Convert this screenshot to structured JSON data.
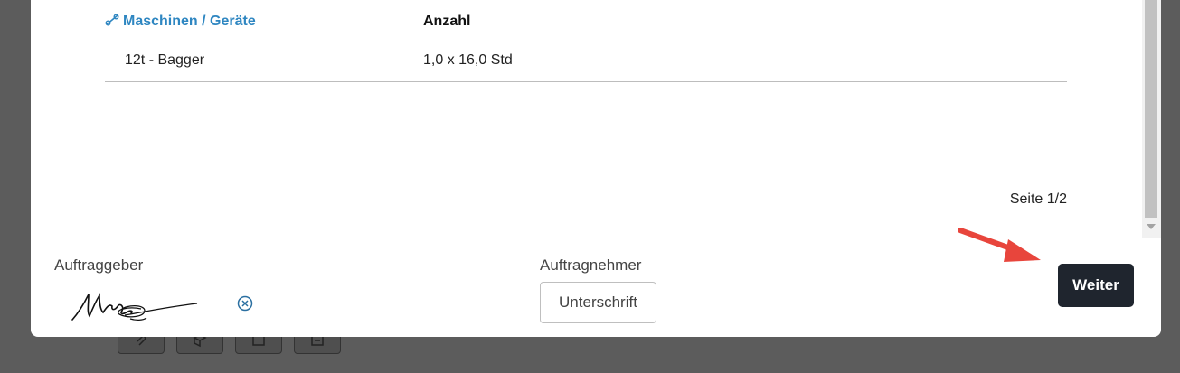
{
  "table": {
    "header_machine": "Maschinen / Geräte",
    "header_count": "Anzahl",
    "rows": [
      {
        "machine": "12t - Bagger",
        "count": "1,0 x 16,0 Std"
      }
    ]
  },
  "pagination": {
    "label": "Seite 1/2"
  },
  "signatures": {
    "client_label": "Auftraggeber",
    "contractor_label": "Auftragnehmer",
    "sign_button": "Unterschrift"
  },
  "actions": {
    "next_label": "Weiter"
  },
  "colors": {
    "link_blue": "#2e86c1",
    "dark_button": "#1f252e",
    "annotation_red": "#e8453c"
  }
}
